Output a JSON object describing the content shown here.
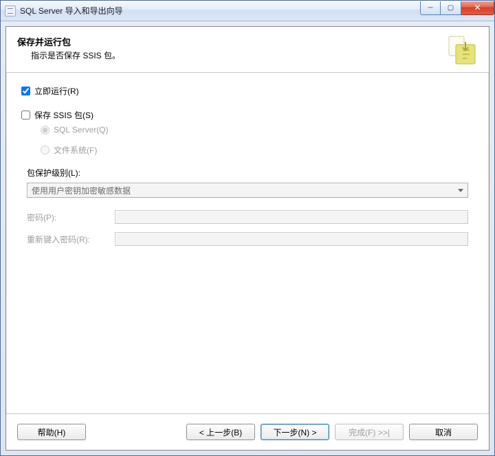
{
  "window": {
    "title": "SQL Server 导入和导出向导"
  },
  "header": {
    "title": "保存并运行包",
    "subtitle": "指示是否保存 SSIS 包。"
  },
  "options": {
    "run_now_label": "立即运行(R)",
    "save_ssis_label": "保存 SSIS 包(S)",
    "sql_server_label": "SQL Server(Q)",
    "filesystem_label": "文件系统(F)"
  },
  "protection": {
    "label": "包保护级别(L):",
    "selected": "使用用户密钥加密敏感数据"
  },
  "fields": {
    "password_label": "密码(P):",
    "retype_label": "重新键入密码(R):"
  },
  "buttons": {
    "help": "帮助(H)",
    "back": "< 上一步(B)",
    "next": "下一步(N) >",
    "finish": "完成(F) >>|",
    "cancel": "取消"
  }
}
